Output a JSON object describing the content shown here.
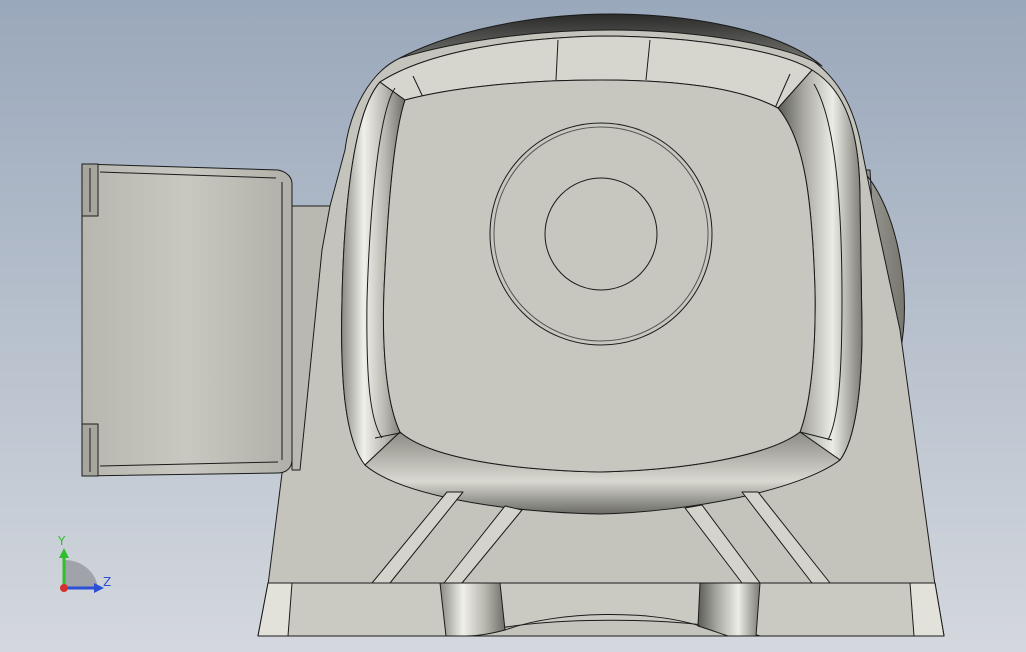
{
  "viewport": {
    "background_top": "#9aa8bb",
    "background_bottom": "#d4d8de"
  },
  "model": {
    "body_color": "#c4c4bc",
    "edge_color": "#1a1a1a",
    "shadow_color": "#6f6f68",
    "highlight_color": "#f2f2ec"
  },
  "triad": {
    "y_label": "Y",
    "z_label": "Z",
    "y_color": "#2fbf2f",
    "z_color": "#2d4fd6",
    "x_color": "#d62d2d"
  }
}
